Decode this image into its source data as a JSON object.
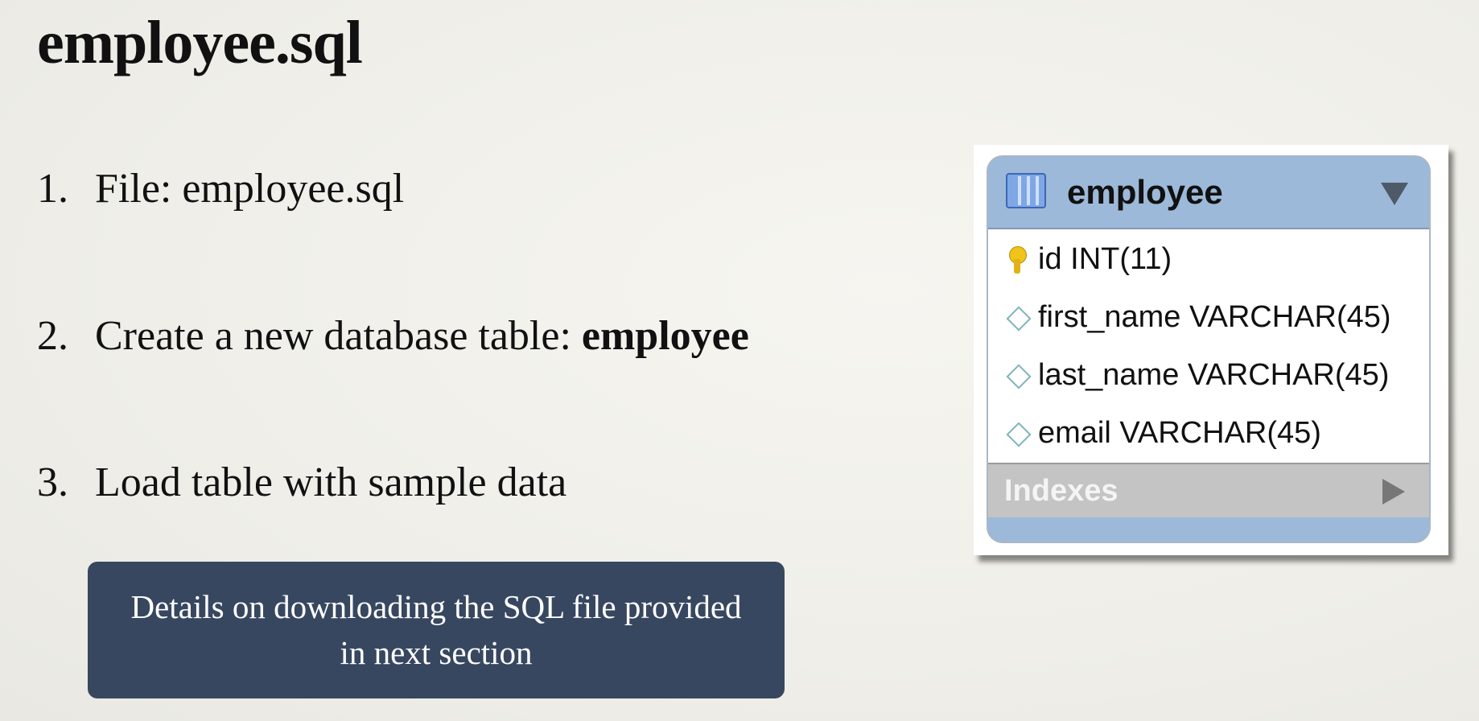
{
  "slide": {
    "title": "employee.sql",
    "steps": [
      {
        "number": "1.",
        "text": "File: employee.sql",
        "bold": ""
      },
      {
        "number": "2.",
        "text": "Create a new database table: ",
        "bold": "employee"
      },
      {
        "number": "3.",
        "text": "Load table with sample data",
        "bold": ""
      }
    ],
    "note": "Details on downloading the SQL file provided in next section"
  },
  "er_table": {
    "name": "employee",
    "icon": "table-icon",
    "columns": [
      {
        "text": "id INT(11)",
        "icon": "primary-key-icon"
      },
      {
        "text": "first_name VARCHAR(45)",
        "icon": "diamond-icon"
      },
      {
        "text": "last_name VARCHAR(45)",
        "icon": "diamond-icon"
      },
      {
        "text": "email VARCHAR(45)",
        "icon": "diamond-icon"
      }
    ],
    "indexes_label": "Indexes"
  },
  "colors": {
    "note_background": "#384760",
    "er_header": "#9db9d9",
    "er_indexes": "#c4c4c4"
  }
}
